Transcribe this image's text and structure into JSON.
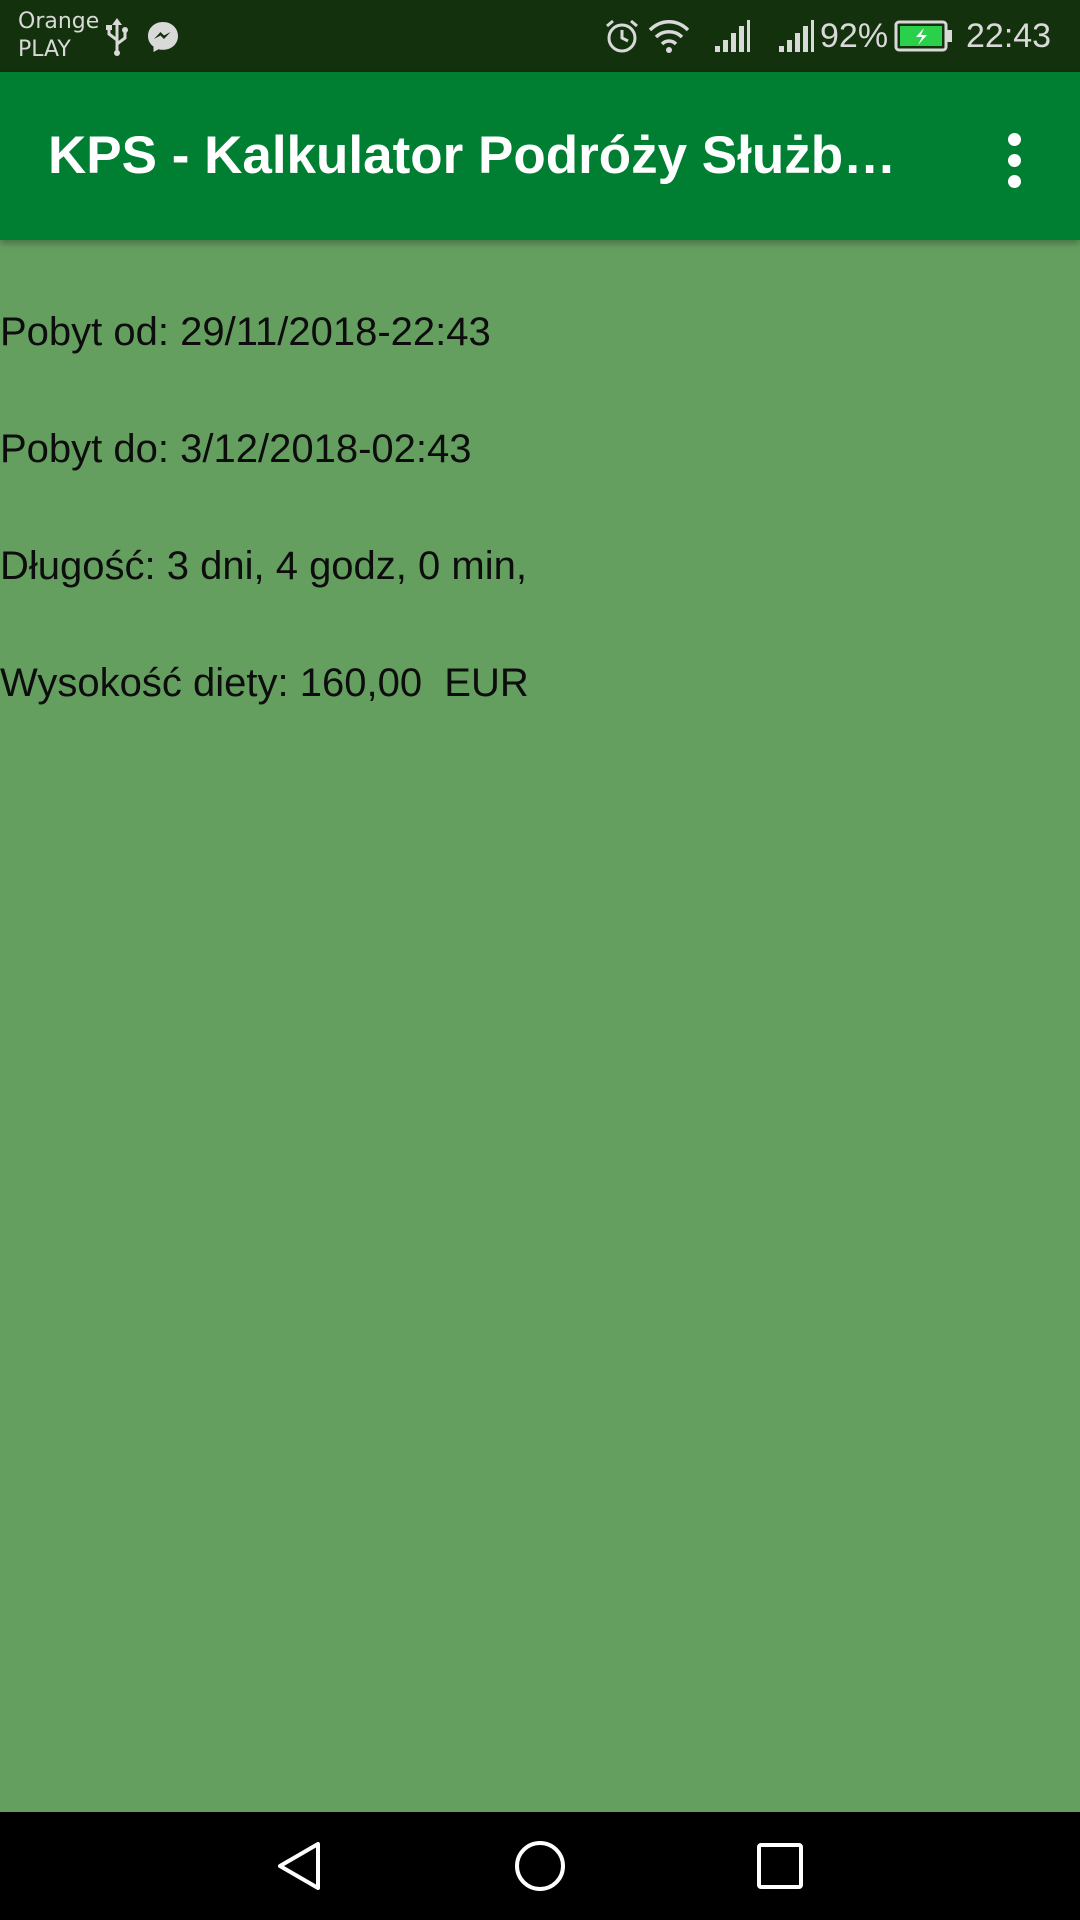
{
  "status_bar": {
    "carrier_line1": "Orange",
    "carrier_line2": "PLAY",
    "battery_percent": "92%",
    "time": "22:43",
    "icons": [
      "usb-icon",
      "messenger-icon",
      "alarm-icon",
      "wifi-icon",
      "signal-icon",
      "signal-icon",
      "battery-charging-icon"
    ]
  },
  "app_bar": {
    "title": "KPS - Kalkulator Podróży Służb…",
    "menu_icon": "more-vert-icon"
  },
  "content": {
    "stay_from": "Pobyt od: 29/11/2018-22:43",
    "stay_to": "Pobyt do: 3/12/2018-02:43",
    "duration": "Długość: 3 dni, 4 godz, 0 min,",
    "allowance": "Wysokość diety: 160,00  EUR"
  },
  "nav_bar": {
    "icons": [
      "back-icon",
      "home-icon",
      "recents-icon"
    ]
  },
  "colors": {
    "status_bar": "#12310c",
    "app_bar": "#007f33",
    "background": "#659f60",
    "text": "#0d0d0d"
  }
}
